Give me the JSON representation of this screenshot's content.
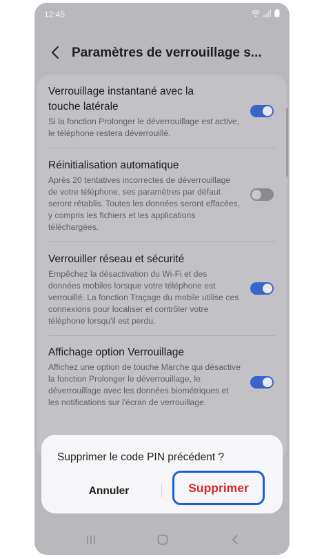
{
  "status_bar": {
    "time": "12:45"
  },
  "header": {
    "title": "Paramètres de verrouillage s..."
  },
  "settings": [
    {
      "title": "Verrouillage instantané avec la touche latérale",
      "description": "Si la fonction Prolonger le déverrouillage est active, le téléphone restera déverrouillé.",
      "enabled": true
    },
    {
      "title": "Réinitialisation automatique",
      "description": "Après 20 tentatives incorrectes de déverrouillage de votre téléphone, ses paramètres par défaut seront rétablis. Toutes les données seront effacées, y compris les fichiers et les applications téléchargées.",
      "enabled": false
    },
    {
      "title": "Verrouiller réseau et sécurité",
      "description": "Empêchez la désactivation du Wi-Fi et des données mobiles lorsque votre téléphone est verrouillé. La fonction Traçage du mobile utilise ces connexions pour localiser et contrôler votre téléphone lorsqu'il est perdu.",
      "enabled": true
    },
    {
      "title": "Affichage option Verrouillage",
      "description": "Affichez une option de touche Marche qui désactive la fonction Prolonger le déverrouillage, le déverrouillage avec les données biométriques et les notifications sur l'écran de verrouillage.",
      "enabled": true
    }
  ],
  "dialog": {
    "message": "Supprimer le code PIN précédent ?",
    "cancel_label": "Annuler",
    "confirm_label": "Supprimer"
  },
  "colors": {
    "accent": "#3b63c9",
    "destructive": "#d62a2a",
    "highlight": "#1a5fd9"
  },
  "icons": {
    "back": "chevron-left-icon",
    "wifi": "wifi-icon",
    "signal": "signal-icon",
    "battery": "battery-icon",
    "nav_recents": "recents-icon",
    "nav_home": "home-icon",
    "nav_back": "back-nav-icon"
  }
}
